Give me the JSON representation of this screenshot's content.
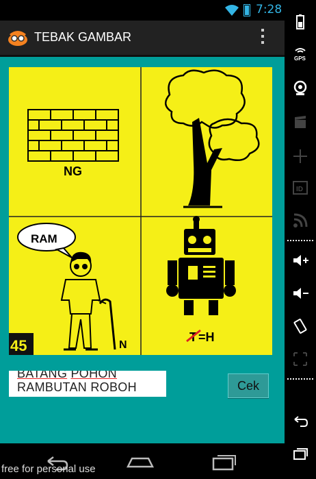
{
  "status_bar": {
    "time": "7:28"
  },
  "action_bar": {
    "title": "TEBAK GAMBAR"
  },
  "puzzle": {
    "number": "45",
    "panel1_text": "NG",
    "panel3_speech": "RAM",
    "panel3_text": "N",
    "panel4_struck": "T",
    "panel4_text": "=H"
  },
  "answer": {
    "line1_a": "BATANG",
    "line1_b": "POHON",
    "line2": "RAMBUTAN ROBOH"
  },
  "check_button": {
    "label": "Cek"
  },
  "watermark": "free for personal use",
  "side_panel": {
    "gps_label": "GPS",
    "id_label": "ID"
  },
  "colors": {
    "teal": "#009e9a",
    "yellow": "#f5ef17",
    "accent": "#33b5e5"
  }
}
